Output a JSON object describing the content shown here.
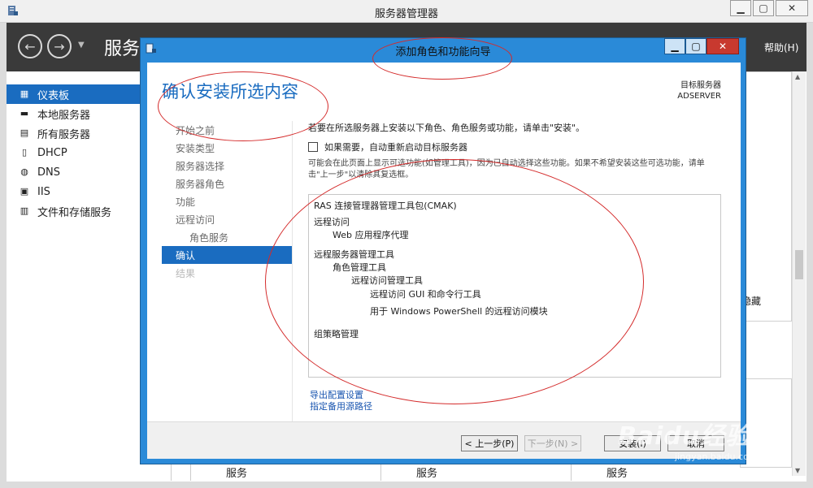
{
  "outer_window": {
    "title": "服务器管理器"
  },
  "server_manager": {
    "header_title": "服务",
    "help_label": "帮助(H)",
    "sidebar": [
      {
        "label": "仪表板",
        "icon": "dashboard-icon",
        "active": true
      },
      {
        "label": "本地服务器",
        "icon": "server-icon"
      },
      {
        "label": "所有服务器",
        "icon": "servers-icon"
      },
      {
        "label": "DHCP",
        "icon": "dhcp-icon"
      },
      {
        "label": "DNS",
        "icon": "dns-icon"
      },
      {
        "label": "IIS",
        "icon": "iis-icon"
      },
      {
        "label": "文件和存储服务",
        "icon": "storage-icon"
      }
    ],
    "hide_label": "隐藏",
    "bottom_columns": [
      "服务",
      "服务",
      "服务"
    ]
  },
  "dialog": {
    "title": "添加角色和功能向导",
    "heading": "确认安装所选内容",
    "target_server_label": "目标服务器",
    "target_server_name": "ADSERVER",
    "steps": [
      {
        "label": "开始之前",
        "state": "normal"
      },
      {
        "label": "安装类型",
        "state": "normal"
      },
      {
        "label": "服务器选择",
        "state": "normal"
      },
      {
        "label": "服务器角色",
        "state": "normal"
      },
      {
        "label": "功能",
        "state": "normal"
      },
      {
        "label": "远程访问",
        "state": "normal"
      },
      {
        "label": "角色服务",
        "state": "sub"
      },
      {
        "label": "确认",
        "state": "active"
      },
      {
        "label": "结果",
        "state": "disabled"
      }
    ],
    "intro_text": "若要在所选服务器上安装以下角色、角色服务或功能，请单击\"安装\"。",
    "restart_checkbox_label": "如果需要，自动重新启动目标服务器",
    "restart_checked": false,
    "note_text": "可能会在此页面上显示可选功能(如管理工具)，因为已自动选择这些功能。如果不希望安装这些可选功能，请单击\"上一步\"以清除其复选框。",
    "features": [
      {
        "label": "RAS 连接管理器管理工具包(CMAK)",
        "level": 0
      },
      {
        "label": "远程访问",
        "level": 0
      },
      {
        "label": "Web 应用程序代理",
        "level": 1
      },
      {
        "label": "远程服务器管理工具",
        "level": 0
      },
      {
        "label": "角色管理工具",
        "level": 1
      },
      {
        "label": "远程访问管理工具",
        "level": 2
      },
      {
        "label": "远程访问 GUI 和命令行工具",
        "level": 3
      },
      {
        "label": "用于 Windows PowerShell 的远程访问模块",
        "level": 3
      },
      {
        "label": "组策略管理",
        "level": 0
      }
    ],
    "links": {
      "export": "导出配置设置",
      "alternate_source": "指定备用源路径"
    },
    "buttons": {
      "previous": "< 上一步(P)",
      "next": "下一步(N) >",
      "install": "安装(I)",
      "cancel": "取消"
    }
  },
  "watermark": {
    "logo": "Baidu经验",
    "url": "jingyan.baidu.com"
  },
  "colors": {
    "accent": "#1a6cc0",
    "dialog_frame": "#2a8ad8",
    "annotation": "#d42b2b"
  }
}
